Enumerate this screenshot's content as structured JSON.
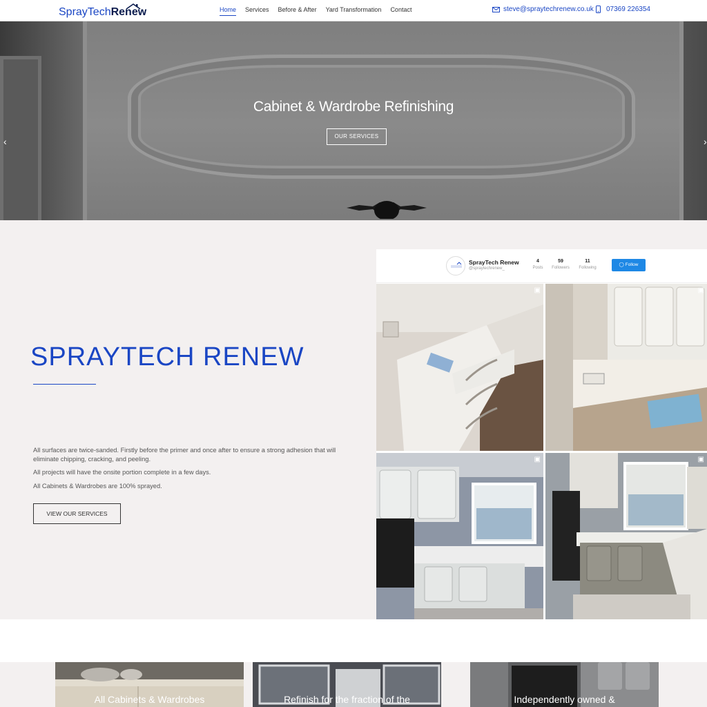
{
  "header": {
    "logo_part1": "SprayTech",
    "logo_part2": "Renew",
    "nav": [
      "Home",
      "Services",
      "Before & After",
      "Yard Transformation",
      "Contact"
    ],
    "email": "steve@spraytechrenew.co.uk",
    "phone": "07369 226354"
  },
  "hero": {
    "title": "Cabinet & Wardrobe Refinishing",
    "button": "OUR SERVICES"
  },
  "about": {
    "title": "SPRAYTECH RENEW",
    "para1": "All surfaces are twice-sanded. Firstly before the primer and once after to ensure a strong adhesion that will eliminate chipping, cracking, and peeling.",
    "para2": "All projects will have the onsite portion complete in a few days.",
    "para3": "All Cabinets & Wardrobes are 100% sprayed.",
    "button": "VIEW OUR SERVICES"
  },
  "instagram": {
    "name": "SprayTech Renew",
    "handle": "@spraytechrenew_",
    "posts": "4",
    "posts_label": "Posts",
    "followers": "59",
    "followers_label": "Followers",
    "following": "11",
    "following_label": "Following",
    "follow_button": "Follow"
  },
  "cards": [
    {
      "text": "All Cabinets & Wardrobes"
    },
    {
      "text": "Refinish for the fraction of the"
    },
    {
      "text": "Independently owned &"
    }
  ],
  "colors": {
    "accent": "#1a46c4",
    "follow": "#1e88e5",
    "section_bg": "#f3f0f0"
  }
}
